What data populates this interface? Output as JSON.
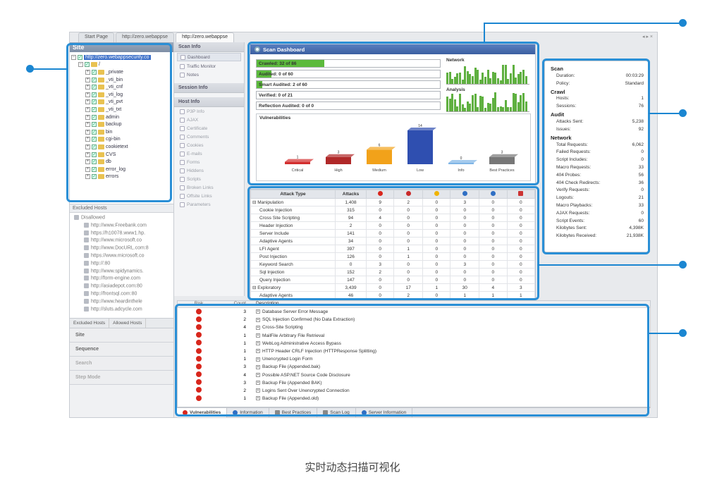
{
  "window": {
    "tabs": [
      "Start Page",
      "http://zero.webappse",
      "http://zero.webappse"
    ],
    "controls": "◂ ▸ ×"
  },
  "site_panel": {
    "title": "Site",
    "root": "http://zero.webappsecurity.co",
    "root_folder": "/",
    "items": [
      "_private",
      "_vti_bin",
      "_vti_cnf",
      "_vti_log",
      "_vti_pvt",
      "_vti_txt",
      "admin",
      "backup",
      "bin",
      "cgi-bin",
      "cookietext",
      "CVS",
      "db",
      "error_log",
      "errors"
    ]
  },
  "excluded": {
    "header": "Excluded Hosts",
    "group": "Disallowed",
    "hosts": [
      "http://www.Freebank.com",
      "https://h10078.www1.hp.",
      "http://www.microsoft.co",
      "http://www.DocURL.com:8",
      "https://www.microsoft.co",
      "http://:80",
      "http://www.spidynamics.",
      "http://form-engine.com",
      "http://asiadepot.com:80",
      "http://frontsql.com:80",
      "http://www.heardinthele",
      "http://sluts.adcycle.com"
    ],
    "tabs": [
      "Excluded Hosts",
      "Allowed Hosts"
    ]
  },
  "left_nav": [
    "Site",
    "Sequence",
    "Search",
    "Step Mode"
  ],
  "scan_info": {
    "header": "Scan Info",
    "items": [
      "Dashboard",
      "Traffic Monitor",
      "Notes"
    ],
    "session_header": "Session Info",
    "host_header": "Host Info",
    "host_items": [
      "P3P Info",
      "AJAX",
      "Certificate",
      "Comments",
      "Cookies",
      "E-mails",
      "Forms",
      "Hiddens",
      "Scripts",
      "Broken Links",
      "Offsite Links",
      "Parameters"
    ]
  },
  "dashboard": {
    "title": "Scan Dashboard",
    "progress": [
      {
        "label": "Crawled: 32 of 86",
        "fill": 0.37
      },
      {
        "label": "Audited: 0 of 60",
        "fill": 0.08
      },
      {
        "label": "Smart Audited: 2 of 60",
        "fill": 0.03
      },
      {
        "label": "Verified: 0 of 21",
        "fill": 0
      },
      {
        "label": "Reflection Audited: 0 of 0",
        "fill": 0
      }
    ],
    "network_label": "Network",
    "analysis_label": "Analysis",
    "vulnerabilities_label": "Vulnerabilities"
  },
  "chart_data": {
    "type": "bar",
    "categories": [
      "Critical",
      "High",
      "Medium",
      "Low",
      "Info",
      "Best Practices"
    ],
    "values": [
      1,
      3,
      6,
      14,
      0,
      3
    ],
    "colors": [
      "#d32f2f",
      "#b02828",
      "#f2a21a",
      "#2f4fb0",
      "#7fb5e6",
      "#777777"
    ],
    "ylim": [
      0,
      14
    ]
  },
  "attacks": {
    "headers": [
      "Attack Type",
      "Attacks"
    ],
    "severity_colors": [
      "#d8261c",
      "#c92a2a",
      "#f0b400",
      "#2f6fc4",
      "#2f6fc4",
      "#cc3333"
    ],
    "rows": [
      {
        "group": true,
        "name": "Manipulation",
        "vals": [
          "1,408",
          "9",
          "2",
          "0",
          "3",
          "0",
          "0"
        ]
      },
      {
        "name": "Cookie Injection",
        "vals": [
          "315",
          "0",
          "0",
          "0",
          "0",
          "0",
          "0"
        ]
      },
      {
        "name": "Cross Site Scripting",
        "vals": [
          "94",
          "4",
          "0",
          "0",
          "0",
          "0",
          "0"
        ]
      },
      {
        "name": "Header Injection",
        "vals": [
          "2",
          "0",
          "0",
          "0",
          "0",
          "0",
          "0"
        ]
      },
      {
        "name": "Server Include",
        "vals": [
          "141",
          "0",
          "0",
          "0",
          "0",
          "0",
          "0"
        ]
      },
      {
        "name": "Adaptive Agents",
        "vals": [
          "34",
          "0",
          "0",
          "0",
          "0",
          "0",
          "0"
        ]
      },
      {
        "name": "LFI Agent",
        "vals": [
          "397",
          "0",
          "1",
          "0",
          "0",
          "0",
          "0"
        ]
      },
      {
        "name": "Post Injection",
        "vals": [
          "126",
          "0",
          "1",
          "0",
          "0",
          "0",
          "0"
        ]
      },
      {
        "name": "Keyword Search",
        "vals": [
          "0",
          "3",
          "0",
          "0",
          "3",
          "0",
          "0"
        ]
      },
      {
        "name": "Sql Injection",
        "vals": [
          "152",
          "2",
          "0",
          "0",
          "0",
          "0",
          "0"
        ]
      },
      {
        "name": "Query Injection",
        "vals": [
          "147",
          "0",
          "0",
          "0",
          "0",
          "0",
          "0"
        ]
      },
      {
        "group": true,
        "name": "Exploratory",
        "vals": [
          "3,439",
          "0",
          "17",
          "1",
          "30",
          "4",
          "3"
        ]
      },
      {
        "name": "Adaptive Agents",
        "vals": [
          "46",
          "0",
          "2",
          "0",
          "1",
          "1",
          "1"
        ]
      }
    ]
  },
  "stats": [
    {
      "section": "Scan",
      "rows": [
        [
          "Duration:",
          "00:03:29"
        ],
        [
          "Policy:",
          "Standard"
        ]
      ]
    },
    {
      "section": "Crawl",
      "rows": [
        [
          "Hosts:",
          "1"
        ],
        [
          "Sessions:",
          "76"
        ]
      ]
    },
    {
      "section": "Audit",
      "rows": [
        [
          "Attacks Sent:",
          "5,238"
        ],
        [
          "Issues:",
          "92"
        ]
      ]
    },
    {
      "section": "Network",
      "rows": [
        [
          "Total Requests:",
          "6,062"
        ],
        [
          "Failed Requests:",
          "0"
        ],
        [
          "Script Includes:",
          "0"
        ],
        [
          "Macro Requests:",
          "33"
        ],
        [
          "404 Probes:",
          "56"
        ],
        [
          "404 Check Redirects:",
          "36"
        ],
        [
          "Verify Requests:",
          "0"
        ],
        [
          "Logouts:",
          "21"
        ],
        [
          "Macro Playbacks:",
          "33"
        ],
        [
          "AJAX Requests:",
          "0"
        ],
        [
          "Script Events:",
          "60"
        ],
        [
          "Kilobytes Sent:",
          "4,398K"
        ],
        [
          "Kilobytes Received:",
          "21,938K"
        ]
      ]
    }
  ],
  "log": {
    "headers": [
      "Risk",
      "Count",
      "Description"
    ],
    "rows": [
      {
        "count": "3",
        "desc": "Database Server Error Message"
      },
      {
        "count": "2",
        "desc": "SQL Injection Confirmed (No Data Extraction)"
      },
      {
        "count": "4",
        "desc": "Cross-Site Scripting"
      },
      {
        "count": "1",
        "desc": "MailFile Arbitrary File Retrieval"
      },
      {
        "count": "1",
        "desc": "WebLog Administrative Access Bypass"
      },
      {
        "count": "1",
        "desc": "HTTP Header CRLF Injection (HTTPResponse Splitting)"
      },
      {
        "count": "1",
        "desc": "Unencrypted Login Form"
      },
      {
        "count": "3",
        "desc": "Backup File (Appended.bak)"
      },
      {
        "count": "4",
        "desc": "Possible ASP.NET Source Code Disclosure"
      },
      {
        "count": "3",
        "desc": "Backup File (Appended BAK)"
      },
      {
        "count": "2",
        "desc": "Logins Sent Over Unencrypted Connection"
      },
      {
        "count": "1",
        "desc": "Backup File (Appended.old)"
      }
    ]
  },
  "bottom_tabs": [
    "Vulnerabilities",
    "Information",
    "Best Practices",
    "Scan Log",
    "Server Information"
  ],
  "caption": "实时动态扫描可视化"
}
